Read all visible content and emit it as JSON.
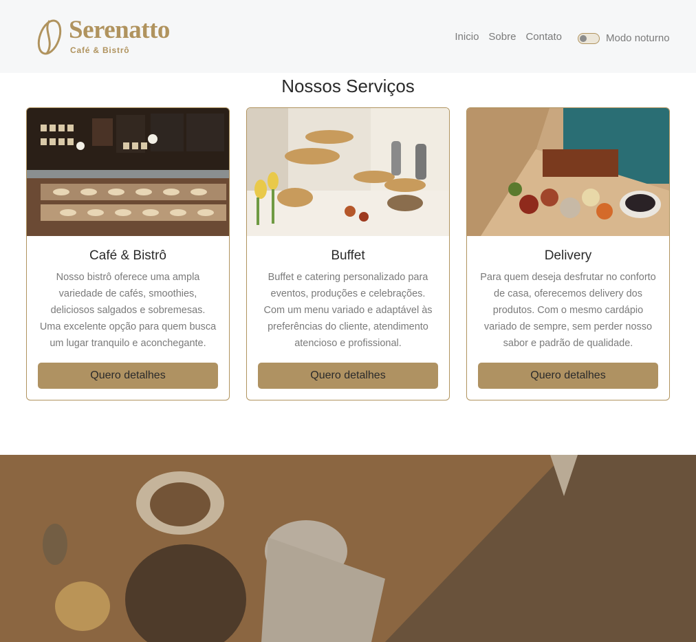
{
  "brand": {
    "name": "Serenatto",
    "subtitle": "Café & Bistrô",
    "color": "#b0935e"
  },
  "nav": {
    "items": [
      "Inicio",
      "Sobre",
      "Contato"
    ],
    "dark_mode_label": "Modo noturno",
    "dark_mode_on": false
  },
  "services": {
    "title": "Nossos Serviços",
    "button_color": "#af9262",
    "cards": [
      {
        "title": "Café & Bistrô",
        "text": "Nosso bistrô oferece uma ampla variedade de cafés, smoothies, deliciosos salgados e sobremesas. Uma excelente opção para quem busca um lugar tranquilo e aconchegante.",
        "button": "Quero detalhes",
        "image": "coffee-shop-counter-photo"
      },
      {
        "title": "Buffet",
        "text": "Buffet e catering personalizado para eventos, produções e celebrações. Com um menu variado e adaptável às preferências do cliente, atendimento atencioso e profissional.",
        "button": "Quero detalhes",
        "image": "buffet-table-photo"
      },
      {
        "title": "Delivery",
        "text": "Para quem deseja desfrutar no conforto de casa, oferecemos delivery dos produtos. Com o mesmo cardápio variado de sempre, sem perder nosso sabor e padrão de qualidade.",
        "button": "Quero detalhes",
        "image": "delivery-food-box-photo"
      }
    ]
  },
  "hero": {
    "image": "person-at-cafe-table-photo"
  }
}
